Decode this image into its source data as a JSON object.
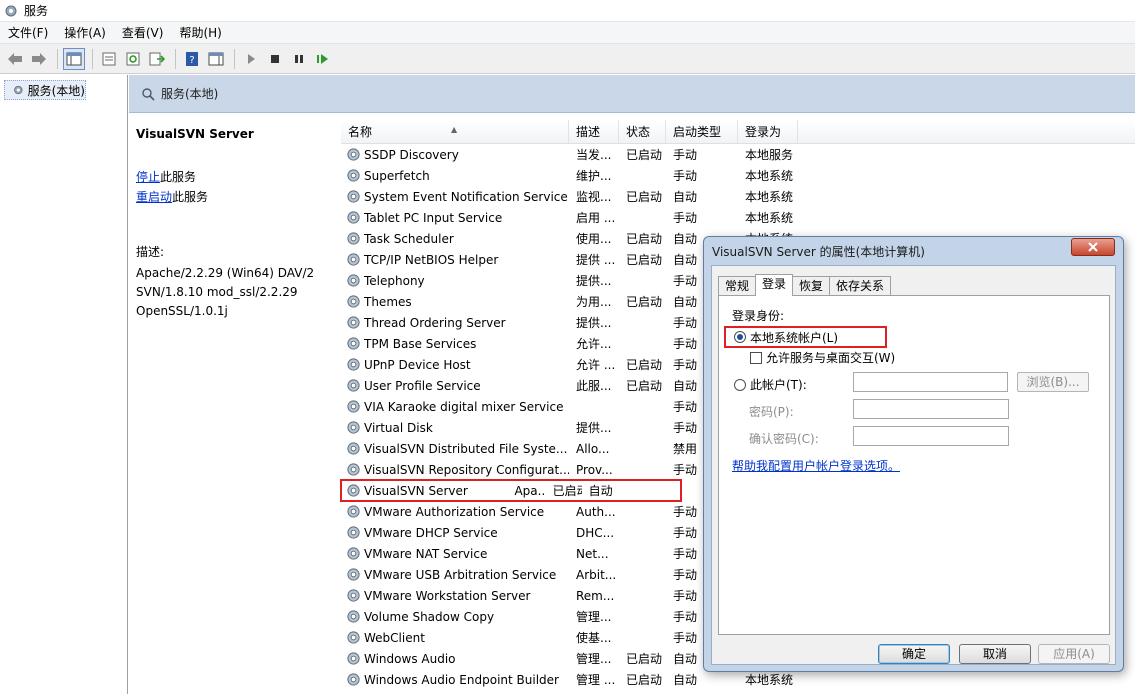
{
  "window": {
    "title": "服务"
  },
  "menu": [
    "文件(F)",
    "操作(A)",
    "查看(V)",
    "帮助(H)"
  ],
  "tree": {
    "root_label": "服务(本地)"
  },
  "main": {
    "header_title": "服务(本地)"
  },
  "description_pane": {
    "service_title": "VisualSVN Server",
    "stop_link": "停止",
    "stop_suffix": "此服务",
    "restart_link": "重启动",
    "restart_suffix": "此服务",
    "desc_label": "描述:",
    "desc_text": "Apache/2.2.29 (Win64) DAV/2 SVN/1.8.10 mod_ssl/2.2.29 OpenSSL/1.0.1j"
  },
  "columns": {
    "name": "名称",
    "desc": "描述",
    "status": "状态",
    "start": "启动类型",
    "logon": "登录为"
  },
  "services": [
    {
      "name": "SSDP Discovery",
      "desc": "当发...",
      "status": "已启动",
      "start": "手动",
      "logon": "本地服务"
    },
    {
      "name": "Superfetch",
      "desc": "维护...",
      "status": "",
      "start": "手动",
      "logon": "本地系统"
    },
    {
      "name": "System Event Notification Service",
      "desc": "监视...",
      "status": "已启动",
      "start": "自动",
      "logon": "本地系统"
    },
    {
      "name": "Tablet PC Input Service",
      "desc": "启用 ...",
      "status": "",
      "start": "手动",
      "logon": "本地系统"
    },
    {
      "name": "Task Scheduler",
      "desc": "使用...",
      "status": "已启动",
      "start": "自动",
      "logon": "本地系统"
    },
    {
      "name": "TCP/IP NetBIOS Helper",
      "desc": "提供 ...",
      "status": "已启动",
      "start": "自动",
      "logon": ""
    },
    {
      "name": "Telephony",
      "desc": "提供...",
      "status": "",
      "start": "手动",
      "logon": ""
    },
    {
      "name": "Themes",
      "desc": "为用...",
      "status": "已启动",
      "start": "自动",
      "logon": ""
    },
    {
      "name": "Thread Ordering Server",
      "desc": "提供...",
      "status": "",
      "start": "手动",
      "logon": ""
    },
    {
      "name": "TPM Base Services",
      "desc": "允许...",
      "status": "",
      "start": "手动",
      "logon": ""
    },
    {
      "name": "UPnP Device Host",
      "desc": "允许 ...",
      "status": "已启动",
      "start": "手动",
      "logon": ""
    },
    {
      "name": "User Profile Service",
      "desc": "此服...",
      "status": "已启动",
      "start": "自动",
      "logon": ""
    },
    {
      "name": "VIA Karaoke digital mixer Service",
      "desc": "",
      "status": "",
      "start": "手动",
      "logon": ""
    },
    {
      "name": "Virtual Disk",
      "desc": "提供...",
      "status": "",
      "start": "手动",
      "logon": ""
    },
    {
      "name": "VisualSVN Distributed File Syste...",
      "desc": "Allo...",
      "status": "",
      "start": "禁用",
      "logon": ""
    },
    {
      "name": "VisualSVN Repository Configurat...",
      "desc": "Prov...",
      "status": "",
      "start": "手动",
      "logon": ""
    },
    {
      "name": "VisualSVN Server",
      "desc": "Apa...",
      "status": "已启动",
      "start": "自动",
      "logon": ""
    },
    {
      "name": "VMware Authorization Service",
      "desc": "Auth...",
      "status": "",
      "start": "手动",
      "logon": ""
    },
    {
      "name": "VMware DHCP Service",
      "desc": "DHC...",
      "status": "",
      "start": "手动",
      "logon": ""
    },
    {
      "name": "VMware NAT Service",
      "desc": "Net...",
      "status": "",
      "start": "手动",
      "logon": ""
    },
    {
      "name": "VMware USB Arbitration Service",
      "desc": "Arbit...",
      "status": "",
      "start": "手动",
      "logon": ""
    },
    {
      "name": "VMware Workstation Server",
      "desc": "Rem...",
      "status": "",
      "start": "手动",
      "logon": ""
    },
    {
      "name": "Volume Shadow Copy",
      "desc": "管理...",
      "status": "",
      "start": "手动",
      "logon": ""
    },
    {
      "name": "WebClient",
      "desc": "使基...",
      "status": "",
      "start": "手动",
      "logon": ""
    },
    {
      "name": "Windows Audio",
      "desc": "管理...",
      "status": "已启动",
      "start": "自动",
      "logon": ""
    },
    {
      "name": "Windows Audio Endpoint Builder",
      "desc": "管理 ...",
      "status": "已启动",
      "start": "自动",
      "logon": "本地系统"
    }
  ],
  "dialog": {
    "title": "VisualSVN Server 的属性(本地计算机)",
    "tabs": [
      "常规",
      "登录",
      "恢复",
      "依存关系"
    ],
    "logon_as_label": "登录身份:",
    "local_system_label": "本地系统帐户(L)",
    "allow_desktop_label": "允许服务与桌面交互(W)",
    "this_account_label": "此帐户(T):",
    "browse_label": "浏览(B)...",
    "password_label": "密码(P):",
    "confirm_label": "确认密码(C):",
    "help_link": "帮助我配置用户帐户登录选项。",
    "ok": "确定",
    "cancel": "取消",
    "apply": "应用(A)"
  }
}
